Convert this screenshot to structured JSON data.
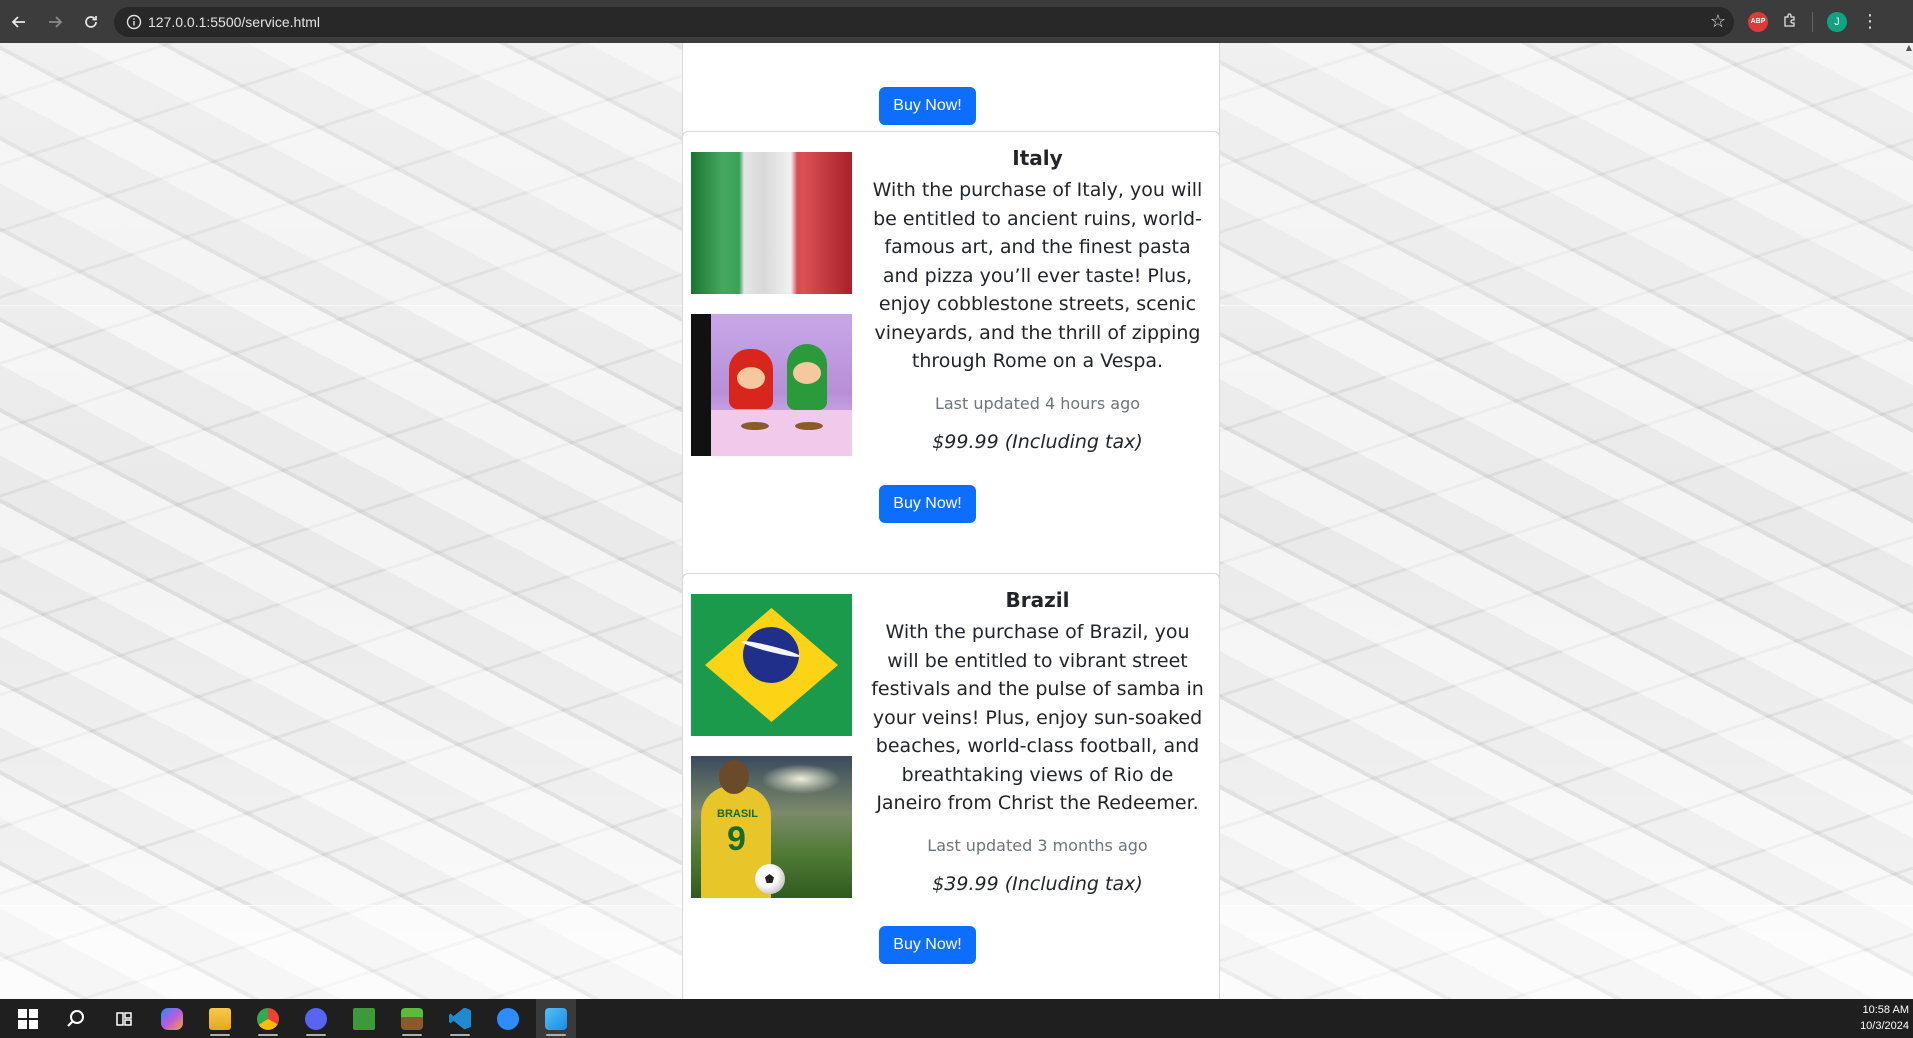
{
  "browser": {
    "url": "127.0.0.1:5500/service.html",
    "back_icon": "arrow-left-icon",
    "forward_icon": "arrow-right-icon",
    "reload_icon": "reload-icon",
    "bookmark_icon": "star-icon",
    "extension_badge": "ABP",
    "profile_initial": "J"
  },
  "top_card": {
    "buy_label": "Buy Now!"
  },
  "products": [
    {
      "name": "Italy",
      "description": "With the purchase of Italy, you will be entitled to ancient ruins, world-famous art, and the finest pasta and pizza you’ll ever taste! Plus, enjoy cobblestone streets, scenic vineyards, and the thrill of zipping through Rome on a Vespa.",
      "updated": "Last updated 4 hours ago",
      "price": "$99.99 (Including tax)",
      "buy_label": "Buy Now!"
    },
    {
      "name": "Brazil",
      "description": "With the purchase of Brazil, you will be entitled to vibrant street festivals and the pulse of samba in your veins! Plus, enjoy sun-soaked beaches, world-class football, and breathtaking views of Rio de Janeiro from Christ the Redeemer.",
      "updated": "Last updated 3 months ago",
      "price": "$39.99 (Including tax)",
      "buy_label": "Buy Now!"
    }
  ],
  "brazil_image": {
    "jersey_text": "BRASIL",
    "jersey_number": "9"
  },
  "taskbar": {
    "time": "10:58 AM",
    "date": "10/3/2024"
  }
}
